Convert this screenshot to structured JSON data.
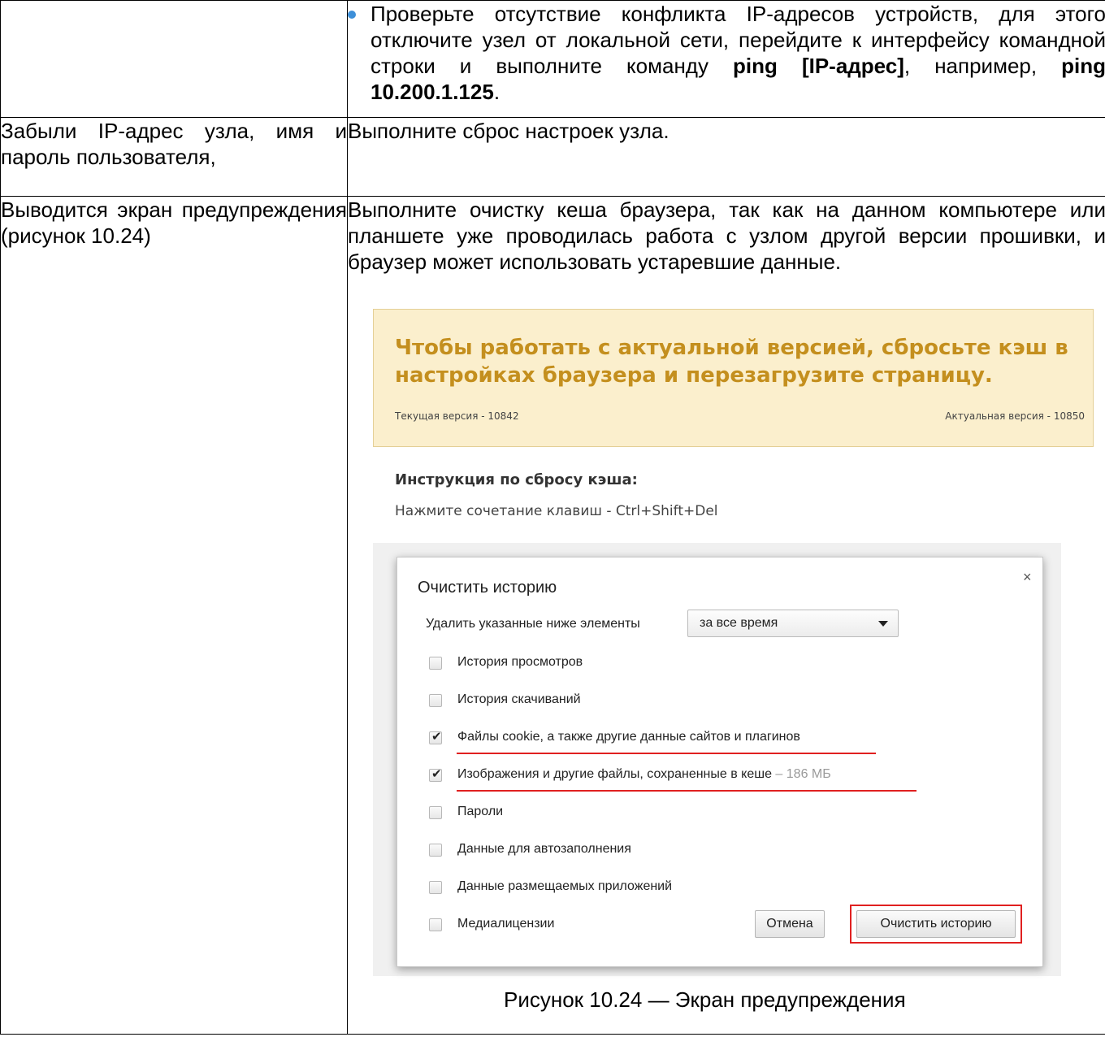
{
  "table": {
    "row1": {
      "left": "",
      "bullet_text_1": "Проверьте отсутствие конфликта IP-адресов устройств, для этого отключите узел от локальной сети, перейдите к интер­фейсу командной строки и выполните команду ",
      "bullet_bold_1": "ping [IP-адрес]",
      "bullet_text_2": ", например, ",
      "bullet_bold_2": "ping 10.200.1.125",
      "bullet_text_3": "."
    },
    "row2": {
      "left": "Забыли IP-адрес узла, имя и пароль пользователя,",
      "right": "Выполните сброс настроек узла."
    },
    "row3": {
      "left": "Выводится экран предупре­ждения (рисунок 10.24)",
      "right": "Выполните очистку кеша браузера, так как на данном компьютере или планшете уже проводилась работа с узлом другой версии про­шивки, и браузер может использовать устаревшие данные."
    }
  },
  "warning": {
    "title": "Чтобы работать с актуальной версией, сбросьте кэш в настройках браузера и перезагрузите страницу.",
    "current_version": "Текущая версия - 10842",
    "actual_version": "Актуальная версия - 10850",
    "instruction_heading": "Инструкция по сбросу кэша:",
    "instruction_text": "Нажмите сочетание клавиш - Ctrl+Shift+Del"
  },
  "dialog": {
    "title": "Очистить историю",
    "close": "×",
    "range_label": "Удалить указанные ниже элементы",
    "range_value": "за все время",
    "options": [
      {
        "label": "История просмотров",
        "checked": false
      },
      {
        "label": "История скачиваний",
        "checked": false
      },
      {
        "label": "Файлы cookie, а также другие данные сайтов и плагинов",
        "checked": true
      },
      {
        "label": "Изображения и другие файлы, сохраненные в кеше",
        "size": " – 186 МБ",
        "checked": true
      },
      {
        "label": "Пароли",
        "checked": false
      },
      {
        "label": "Данные для автозаполнения",
        "checked": false
      },
      {
        "label": "Данные размещаемых приложений",
        "checked": false
      },
      {
        "label": "Медиалицензии",
        "checked": false
      }
    ],
    "check_mark": "✔",
    "cancel_label": "Отмена",
    "clear_label": "Очистить историю"
  },
  "caption": "Рисунок 10.24 — Экран предупреждения",
  "colors": {
    "bullet": "#3d8fd8",
    "warning_bg": "#fbefcd",
    "warning_title": "#c48f1e",
    "highlight_red": "#e02020"
  }
}
